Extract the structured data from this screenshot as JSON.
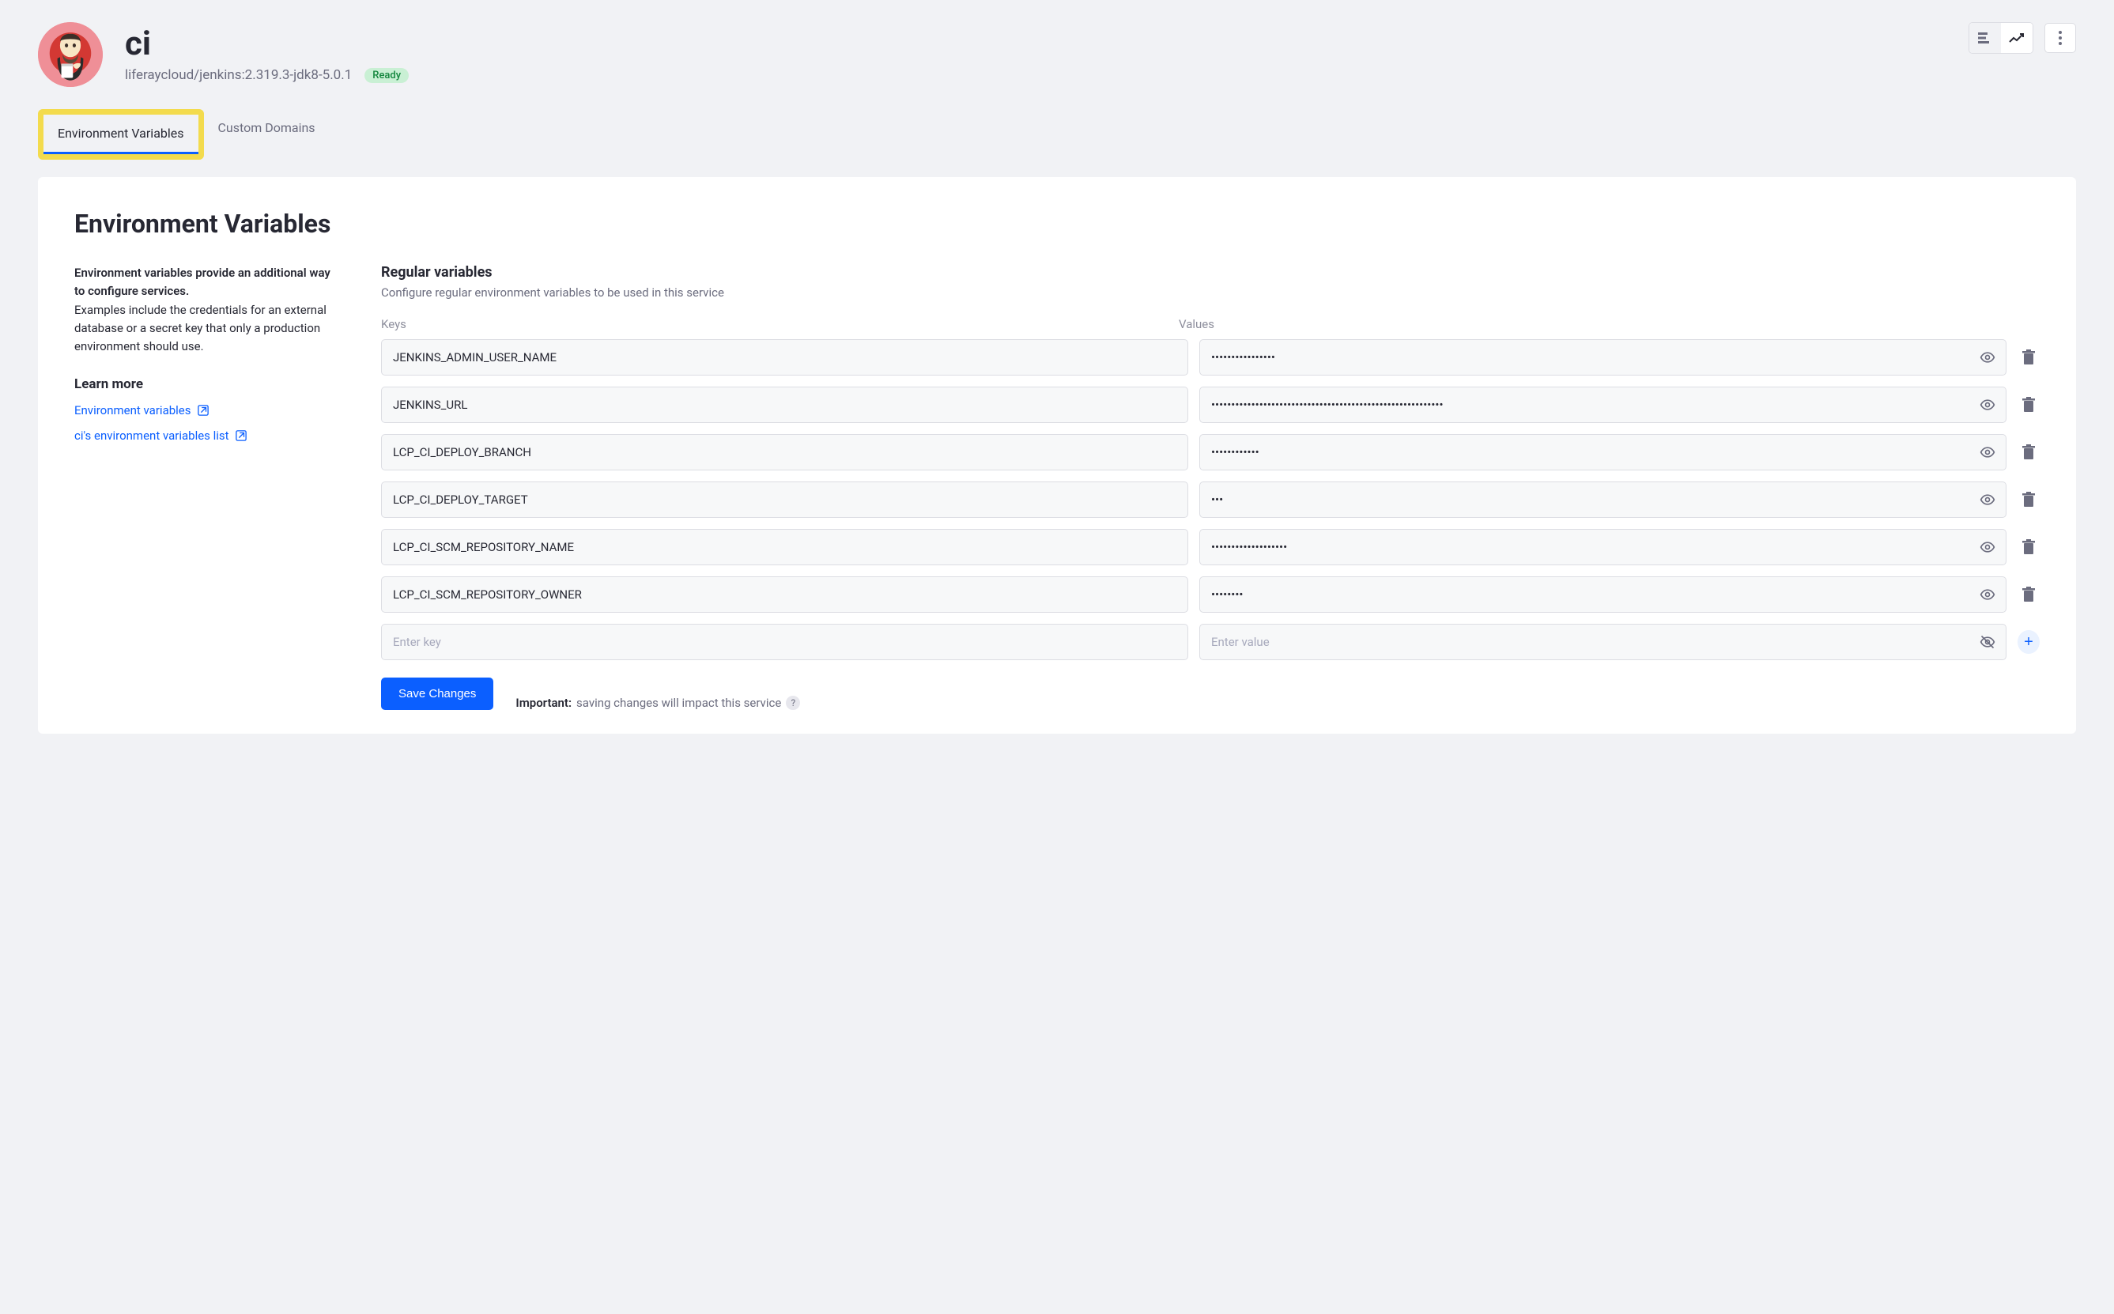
{
  "header": {
    "title": "ci",
    "subtitle": "liferaycloud/jenkins:2.319.3-jdk8-5.0.1",
    "badge": "Ready"
  },
  "tabs": {
    "env": "Environment Variables",
    "domains": "Custom Domains"
  },
  "panel": {
    "heading": "Environment Variables"
  },
  "sidebar": {
    "intro_bold": "Environment variables provide an additional way to configure services.",
    "intro_rest": "Examples include the credentials for an external database or a secret key that only a production environment should use.",
    "learn_more": "Learn more",
    "link1": "Environment variables",
    "link2": "ci's environment variables list"
  },
  "main": {
    "section_title": "Regular variables",
    "section_desc": "Configure regular environment variables to be used in this service",
    "col_keys": "Keys",
    "col_values": "Values",
    "key_placeholder": "Enter key",
    "value_placeholder": "Enter value",
    "rows": [
      {
        "key": "JENKINS_ADMIN_USER_NAME",
        "value": "••••••••••••••••"
      },
      {
        "key": "JENKINS_URL",
        "value": "••••••••••••••••••••••••••••••••••••••••••••••••••••••••••"
      },
      {
        "key": "LCP_CI_DEPLOY_BRANCH",
        "value": "••••••••••••"
      },
      {
        "key": "LCP_CI_DEPLOY_TARGET",
        "value": "•••"
      },
      {
        "key": "LCP_CI_SCM_REPOSITORY_NAME",
        "value": "•••••••••••••••••••"
      },
      {
        "key": "LCP_CI_SCM_REPOSITORY_OWNER",
        "value": "••••••••"
      }
    ]
  },
  "footer": {
    "save": "Save Changes",
    "important_label": "Important:",
    "important_text": " saving changes will impact this service"
  }
}
